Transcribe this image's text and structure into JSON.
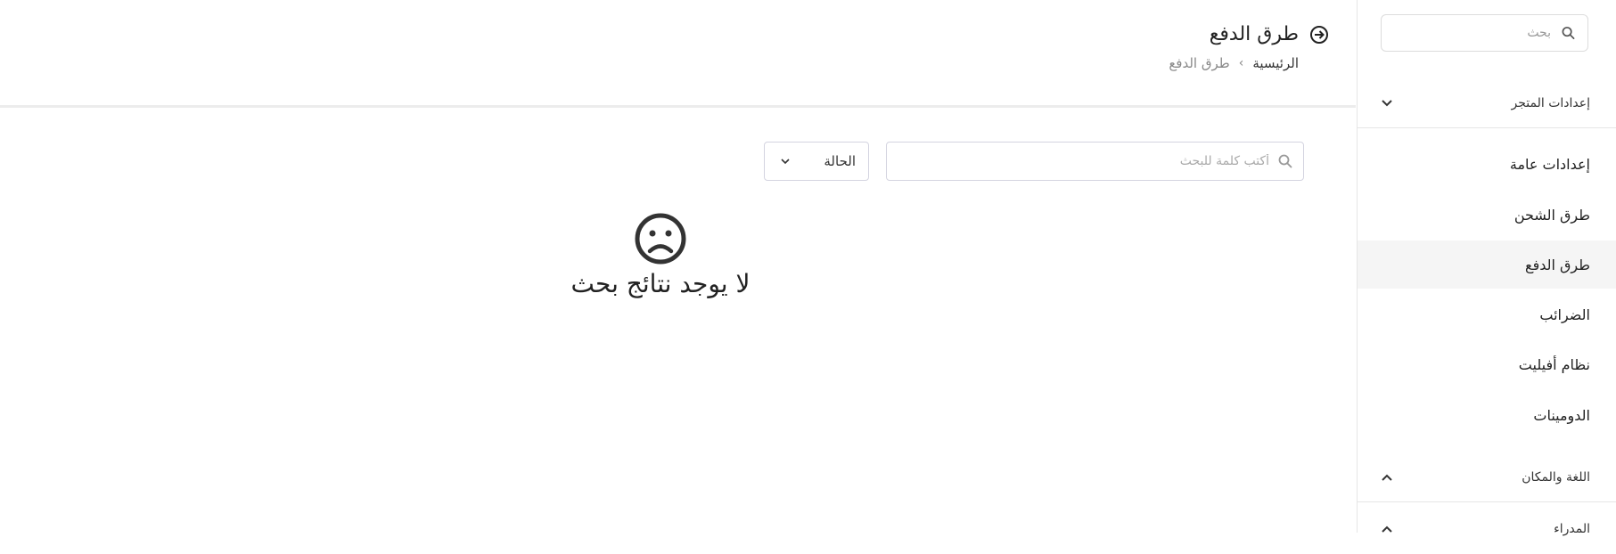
{
  "sidebar": {
    "search_placeholder": "بحث",
    "sections": [
      {
        "label": "إعدادات المتجر",
        "state": "expanded"
      },
      {
        "label": "اللغة والمكان",
        "state": "collapsed"
      },
      {
        "label": "المدراء",
        "state": "collapsed"
      }
    ],
    "items": [
      {
        "label": "إعدادات عامة"
      },
      {
        "label": "طرق الشحن"
      },
      {
        "label": "طرق الدفع",
        "active": true
      },
      {
        "label": "الضرائب"
      },
      {
        "label": "نظام أفيليت"
      },
      {
        "label": "الدومينات"
      }
    ]
  },
  "header": {
    "title": "طرق الدفع",
    "breadcrumb": {
      "home": "الرئيسية",
      "separator": "›",
      "current": "طرق الدفع"
    }
  },
  "filters": {
    "search_placeholder": "أكتب كلمة للبحث",
    "status_label": "الحالة"
  },
  "empty_state": {
    "icon": "sad-face-icon",
    "message": "لا يوجد نتائج بحث"
  },
  "colors": {
    "border": "#d4d4e0",
    "active_bg": "#f5f5f5",
    "text": "#222222"
  }
}
